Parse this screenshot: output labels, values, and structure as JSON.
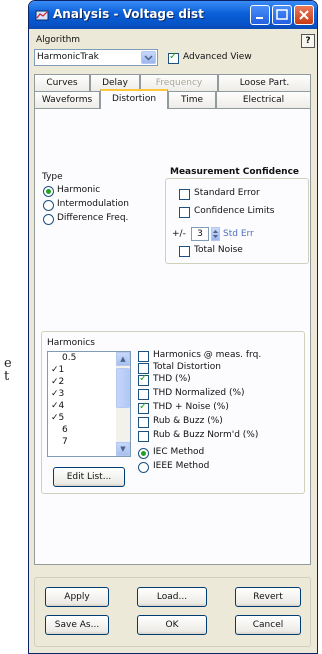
{
  "stray_text": {
    "line1": "e",
    "line2": "t"
  },
  "window": {
    "title": "Analysis - Voltage dist",
    "help_label": "?"
  },
  "algorithm": {
    "label": "Algorithm",
    "value": "HarmonicTrak",
    "advanced_view_label": "Advanced View",
    "advanced_view_checked": true
  },
  "tabs_row1": [
    "Curves",
    "Delay",
    "Frequency",
    "Loose Part."
  ],
  "tabs_row2": [
    "Waveforms",
    "Distortion",
    "Time",
    "Electrical"
  ],
  "active_tab": "Distortion",
  "type_group": {
    "label": "Type",
    "options": [
      "Harmonic",
      "Intermodulation",
      "Difference Freq."
    ],
    "selected": "Harmonic"
  },
  "confidence": {
    "label": "Measurement Confidence",
    "standard_error": "Standard Error",
    "confidence_limits": "Confidence Limits",
    "plus_minus": "+/-",
    "spin_value": "3",
    "unit": "Std Err",
    "total_noise": "Total Noise"
  },
  "harmonics": {
    "label": "Harmonics",
    "items": [
      "0.5",
      "✓1",
      "✓2",
      "✓3",
      "✓4",
      "✓5",
      "6",
      "7"
    ],
    "edit_button": "Edit List..."
  },
  "options": {
    "items": [
      {
        "label": "Harmonics @ meas. frq.",
        "checked": false
      },
      {
        "label": "Total Distortion",
        "checked": false
      },
      {
        "label": "THD (%)",
        "checked": true
      },
      {
        "label": "THD Normalized (%)",
        "checked": false
      },
      {
        "label": "THD + Noise (%)",
        "checked": true
      },
      {
        "label": "Rub & Buzz (%)",
        "checked": false
      },
      {
        "label": "Rub & Buzz Norm'd (%)",
        "checked": false
      }
    ],
    "methods": [
      "IEC Method",
      "IEEE Method"
    ],
    "selected_method": "IEC Method"
  },
  "buttons": {
    "apply": "Apply",
    "load": "Load...",
    "revert": "Revert",
    "save_as": "Save As...",
    "ok": "OK",
    "cancel": "Cancel"
  }
}
